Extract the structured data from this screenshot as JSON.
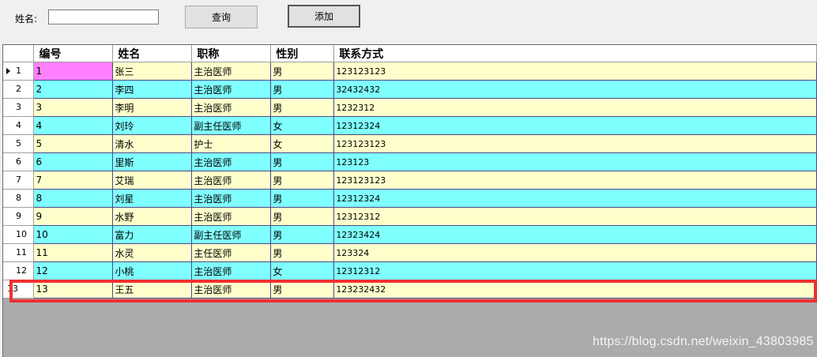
{
  "form": {
    "name_label": "姓名:",
    "name_value": "",
    "query_button": "查询",
    "add_button": "添加"
  },
  "grid": {
    "columns": [
      "编号",
      "姓名",
      "职称",
      "性别",
      "联系方式"
    ],
    "rows": [
      {
        "rownum": "1",
        "id": "1",
        "name": "张三",
        "title": "主治医师",
        "sex": "男",
        "contact": "123123123"
      },
      {
        "rownum": "2",
        "id": "2",
        "name": "李四",
        "title": "主治医师",
        "sex": "男",
        "contact": "32432432"
      },
      {
        "rownum": "3",
        "id": "3",
        "name": "李明",
        "title": "主治医师",
        "sex": "男",
        "contact": "1232312"
      },
      {
        "rownum": "4",
        "id": "4",
        "name": "刘玲",
        "title": "副主任医师",
        "sex": "女",
        "contact": "12312324"
      },
      {
        "rownum": "5",
        "id": "5",
        "name": "清水",
        "title": "护士",
        "sex": "女",
        "contact": "123123123"
      },
      {
        "rownum": "6",
        "id": "6",
        "name": "里斯",
        "title": "主治医师",
        "sex": "男",
        "contact": "123123"
      },
      {
        "rownum": "7",
        "id": "7",
        "name": "艾瑞",
        "title": "主治医师",
        "sex": "男",
        "contact": "123123123"
      },
      {
        "rownum": "8",
        "id": "8",
        "name": "刘星",
        "title": "主治医师",
        "sex": "男",
        "contact": "12312324"
      },
      {
        "rownum": "9",
        "id": "9",
        "name": "水野",
        "title": "主治医师",
        "sex": "男",
        "contact": "12312312"
      },
      {
        "rownum": "10",
        "id": "10",
        "name": "富力",
        "title": "副主任医师",
        "sex": "男",
        "contact": "12323424"
      },
      {
        "rownum": "11",
        "id": "11",
        "name": "水灵",
        "title": "主任医师",
        "sex": "男",
        "contact": "123324"
      },
      {
        "rownum": "12",
        "id": "12",
        "name": "小桃",
        "title": "主治医师",
        "sex": "女",
        "contact": "12312312"
      },
      {
        "rownum": "13",
        "id": "13",
        "name": "王五",
        "title": "主治医师",
        "sex": "男",
        "contact": "123232432"
      }
    ]
  },
  "colors": {
    "row_odd": "#ffffcc",
    "row_even": "#80ffff",
    "selected_cell": "#ff80ff",
    "highlight_border": "#ee3030",
    "grid_empty_bg": "#ababab"
  },
  "watermark": "https://blog.csdn.net/weixin_43803985"
}
